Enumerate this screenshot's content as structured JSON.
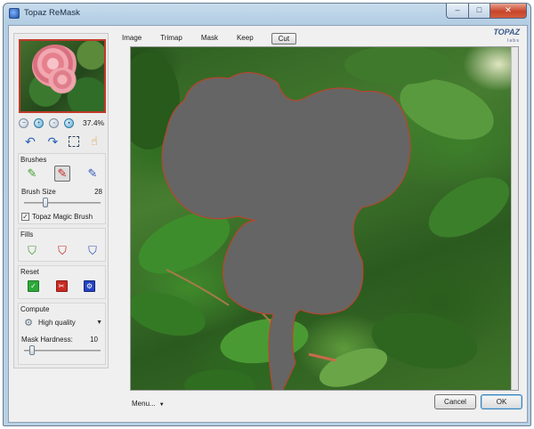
{
  "window": {
    "title": "Topaz ReMask",
    "controls": {
      "minimize": "–",
      "maximize": "□",
      "close": "✕"
    }
  },
  "left_panel": {
    "zoom": {
      "value": "37.4%",
      "buttons": [
        "zoom-out-icon",
        "zoom-in-icon",
        "fit-icon",
        "actual-size-icon"
      ]
    },
    "tools": [
      "undo-icon",
      "redo-icon",
      "selection-icon",
      "hand-icon"
    ],
    "brushes": {
      "title": "Brushes",
      "items": [
        "keep-brush-icon",
        "cut-brush-icon",
        "compute-brush-icon"
      ],
      "selected_index": 1,
      "brush_size_label": "Brush Size",
      "brush_size_value": "28",
      "brush_size_level": 0.28,
      "magic_brush_label": "Topaz Magic Brush",
      "magic_brush_checked": true
    },
    "fills": {
      "title": "Fills",
      "items": [
        "keep-fill-icon",
        "cut-fill-icon",
        "compute-fill-icon"
      ]
    },
    "reset": {
      "title": "Reset",
      "items": [
        "reset-keep-icon",
        "reset-cut-icon",
        "reset-compute-icon"
      ]
    },
    "compute": {
      "title": "Compute",
      "quality_label": "High quality",
      "mask_hardness_label": "Mask Hardness:",
      "mask_hardness_value": "10",
      "mask_hardness_level": 0.1
    }
  },
  "tabs": [
    {
      "label": "Image",
      "active": false
    },
    {
      "label": "Trimap",
      "active": false
    },
    {
      "label": "Mask",
      "active": false
    },
    {
      "label": "Keep",
      "active": false
    },
    {
      "label": "Cut",
      "active": true
    }
  ],
  "logo": {
    "text": "TOPAZ",
    "sub": "labs"
  },
  "bottom": {
    "menu_label": "Menu...",
    "cancel_label": "Cancel",
    "ok_label": "OK"
  },
  "colors": {
    "mask_gray": "#656565",
    "mask_edge": "#b6452f",
    "thumbnail_border": "#c03a2a",
    "window_frame": "#b3cde3"
  }
}
